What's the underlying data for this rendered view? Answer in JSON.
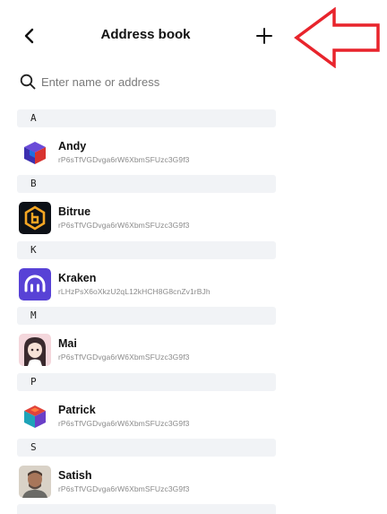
{
  "header": {
    "title": "Address book",
    "back_icon": "chevron-left-icon",
    "add_icon": "plus-icon"
  },
  "annotation": {
    "shape": "arrow-left",
    "color": "#e8242c"
  },
  "search": {
    "placeholder": "Enter name or address",
    "value": ""
  },
  "sections": [
    {
      "letter": "A",
      "contacts": [
        {
          "name": "Andy",
          "address": "rP6sTfVGDvga6rW6XbmSFUzc3G9f3",
          "avatar": "blue-red-cube-avatar"
        }
      ]
    },
    {
      "letter": "B",
      "contacts": [
        {
          "name": "Bitrue",
          "address": "rP6sTfVGDvga6rW6XbmSFUzc3G9f3",
          "avatar": "bitrue-logo"
        }
      ]
    },
    {
      "letter": "K",
      "contacts": [
        {
          "name": "Kraken",
          "address": "rLHzPsX6oXkzU2qL12kHCH8G8cnZv1rBJh",
          "avatar": "kraken-logo"
        }
      ]
    },
    {
      "letter": "M",
      "contacts": [
        {
          "name": "Mai",
          "address": "rP6sTfVGDvga6rW6XbmSFUzc3G9f3",
          "avatar": "anime-girl-avatar"
        }
      ]
    },
    {
      "letter": "P",
      "contacts": [
        {
          "name": "Patrick",
          "address": "rP6sTfVGDvga6rW6XbmSFUzc3G9f3",
          "avatar": "red-teal-cube-avatar"
        }
      ]
    },
    {
      "letter": "S",
      "contacts": [
        {
          "name": "Satish",
          "address": "rP6sTfVGDvga6rW6XbmSFUzc3G9f3",
          "avatar": "person-photo-avatar"
        }
      ]
    }
  ],
  "colors": {
    "section_bg": "#f1f3f6",
    "address_text": "#8a8a8a",
    "kraken": "#5842d6",
    "bitrue_gold": "#f5a623"
  }
}
